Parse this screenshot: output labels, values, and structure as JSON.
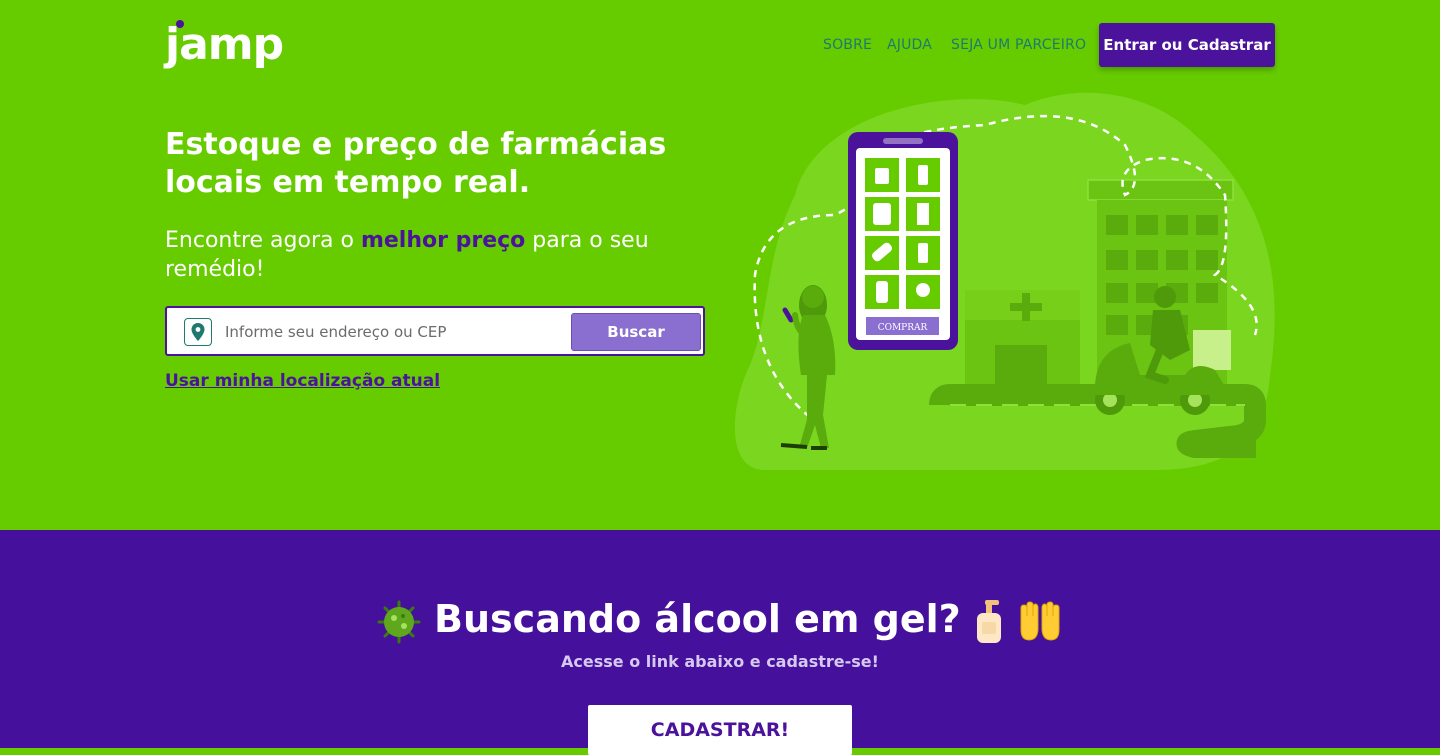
{
  "brand": {
    "logo_text": "jamp"
  },
  "nav": {
    "items": [
      {
        "label": "SOBRE"
      },
      {
        "label": "AJUDA"
      },
      {
        "label": "SEJA UM PARCEIRO"
      }
    ],
    "login_label": "Entrar ou Cadastrar"
  },
  "hero": {
    "headline": "Estoque e preço de farmácias locais em tempo real.",
    "sub_pre": "Encontre agora o ",
    "sub_highlight": "melhor preço",
    "sub_post": " para o seu remédio!",
    "search": {
      "placeholder": "Informe seu endereço ou CEP",
      "value": "",
      "button_label": "Buscar",
      "icon": "location-pin-icon"
    },
    "location_link": "Usar minha localização atual"
  },
  "illustration": {
    "phone_button_label": "COMPRAR"
  },
  "promo": {
    "title": "Buscando álcool em gel?",
    "subtitle": "Acesse o link abaixo e cadastre-se!",
    "button_label": "CADASTRAR!"
  },
  "colors": {
    "hero_bg": "#66cc00",
    "brand_purple": "#4b139c",
    "nav_text": "#1e7a70",
    "promo_bg": "#45109c",
    "search_button": "#8a6fd0"
  }
}
